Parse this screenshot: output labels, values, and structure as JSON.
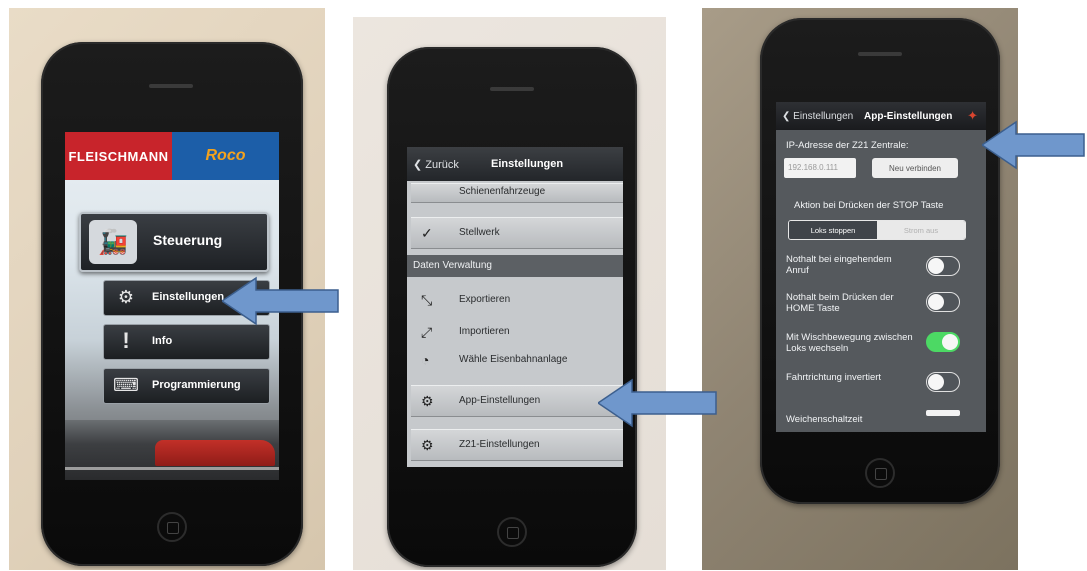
{
  "screen1": {
    "brand_left": "FLEISCHMANN",
    "brand_right": "Roco",
    "menu_main": {
      "label": "Steuerung",
      "icon": "train-control-icon"
    },
    "menu_items": [
      {
        "label": "Einstellungen",
        "icon": "gear-settings-icon"
      },
      {
        "label": "Info",
        "icon": "info-icon"
      },
      {
        "label": "Programmierung",
        "icon": "keyboard-icon"
      }
    ]
  },
  "screen2": {
    "back_label": "Zurück",
    "title": "Einstellungen",
    "top_row": "Schienenfahrzeuge",
    "rows_a": [
      {
        "label": "Stellwerk",
        "icon": "check-icon"
      }
    ],
    "section": "Daten Verwaltung",
    "rows_b": [
      {
        "label": "Exportieren",
        "icon": "export-icon"
      },
      {
        "label": "Importieren",
        "icon": "import-icon"
      },
      {
        "label": "Wähle Eisenbahnanlage",
        "icon": "layout-icon"
      },
      {
        "label": "App-Einstellungen",
        "icon": "gears-icon"
      },
      {
        "label": "Z21-Einstellungen",
        "icon": "z21-icon"
      }
    ]
  },
  "screen3": {
    "back_label": "Einstellungen",
    "title": "App-Einstellungen",
    "ip_label": "IP-Adresse der Z21 Zentrale:",
    "ip_value": "192.168.0.111",
    "detect_button": "Neu verbinden",
    "stop_action_label": "Aktion bei Drücken der STOP Taste",
    "segment_options": [
      "Loks stoppen",
      "Strom aus"
    ],
    "segment_selected": "Loks stoppen",
    "toggles": [
      {
        "label": "Nothalt bei eingehendem Anruf",
        "on": false
      },
      {
        "label": "Nothalt beim Drücken der HOME Taste",
        "on": false
      },
      {
        "label": "Mit Wischbewegung zwischen Loks wechseln",
        "on": true
      },
      {
        "label": "Fahrtrichtung invertiert",
        "on": false
      }
    ],
    "cut_off_label": "Weichenschaltzeit"
  },
  "colors": {
    "arrow_fill": "#6f97cc",
    "arrow_stroke": "#3c5f8e",
    "toggle_on": "#4cd964"
  }
}
